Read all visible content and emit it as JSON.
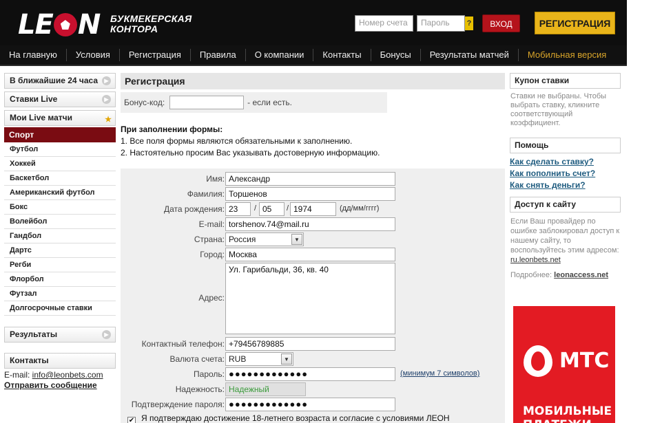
{
  "header": {
    "logo_text": "LEON",
    "tagline_line1": "БУКМЕКЕРСКАЯ",
    "tagline_line2": "КОНТОРА",
    "account_placeholder": "Номер счета",
    "password_placeholder": "Пароль",
    "help_mark": "?",
    "login_label": "ВХОД",
    "register_label": "РЕГИСТРАЦИЯ"
  },
  "nav": {
    "items": [
      "На главную",
      "Условия",
      "Регистрация",
      "Правила",
      "О компании",
      "Контакты",
      "Бонусы",
      "Результаты матчей",
      "Мобильная версия"
    ]
  },
  "sidebar": {
    "next24": "В ближайшие 24 часа",
    "live_bets": "Ставки Live",
    "my_live": "Мои Live матчи",
    "sport_title": "Спорт",
    "sports": [
      "Футбол",
      "Хоккей",
      "Баскетбол",
      "Американский футбол",
      "Бокс",
      "Волейбол",
      "Гандбол",
      "Дартс",
      "Регби",
      "Флорбол",
      "Футзал",
      "Долгосрочные ставки"
    ],
    "results": "Результаты",
    "contacts_title": "Контакты",
    "email_label": "E-mail: ",
    "email_value": "info@leonbets.com",
    "send_message": "Отправить сообщение"
  },
  "main": {
    "title": "Регистрация",
    "bonus_label": "Бонус-код:",
    "bonus_suffix": "- если есть.",
    "instr_title": "При заполнении формы:",
    "instr_1": "1. Все поля формы являются обязательными к заполнению.",
    "instr_2": "2. Настоятельно просим Вас указывать достоверную информацию.",
    "form": {
      "name_label": "Имя:",
      "name_value": "Александр",
      "surname_label": "Фамилия:",
      "surname_value": "Торшенов",
      "dob_label": "Дата рождения:",
      "dob_day": "23",
      "dob_month": "05",
      "dob_year": "1974",
      "dob_sep": "/",
      "dob_hint": "(дд/мм/гггг)",
      "email_label": "E-mail:",
      "email_value": "torshenov.74@mail.ru",
      "country_label": "Страна:",
      "country_value": "Россия",
      "city_label": "Город:",
      "city_value": "Москва",
      "address_label": "Адрес:",
      "address_value": "Ул. Гарибальди, 36, кв. 40",
      "phone_label": "Контактный телефон:",
      "phone_value": "+79456789885",
      "currency_label": "Валюта счета:",
      "currency_value": "RUB",
      "password_label": "Пароль:",
      "password_value": "●●●●●●●●●●●●●",
      "password_hint": "(минимум 7 символов)",
      "reliability_label": "Надежность:",
      "reliability_value": "Надежный",
      "confirm_label": "Подтверждение пароля:",
      "confirm_value": "●●●●●●●●●●●●●",
      "agree_text": "Я подтверждаю достижение 18-летнего возраста и согласие с условиями ЛЕОН"
    }
  },
  "right": {
    "coupon_title": "Купон ставки",
    "coupon_text": "Ставки не выбраны. Чтобы выбрать ставку, кликните соответствующий коэффициент.",
    "help_title": "Помощь",
    "help_links": [
      "Как сделать ставку?",
      "Как пополнить счет?",
      "Как снять деньги?"
    ],
    "access_title": "Доступ к сайту",
    "access_text": "Если Ваш провайдер по ошибке заблокировал доступ к нашему сайту, то воспользуйтесь этим адресом:",
    "access_link": "ru.leonbets.net",
    "proxy_label": "Подробнее:",
    "proxy_link": "leonaccess.net",
    "ad_brand": "МТС",
    "ad_text": "МОБИЛЬНЫЕ ПЛАТЕЖИ"
  },
  "colors": {
    "header_bg": "#0e0e0e",
    "register_btn": "#e9b41a",
    "login_btn": "#b5131b",
    "sport_active": "#7a0c12",
    "link_blue": "#1e5b7f",
    "mts_red": "#e31b23"
  }
}
